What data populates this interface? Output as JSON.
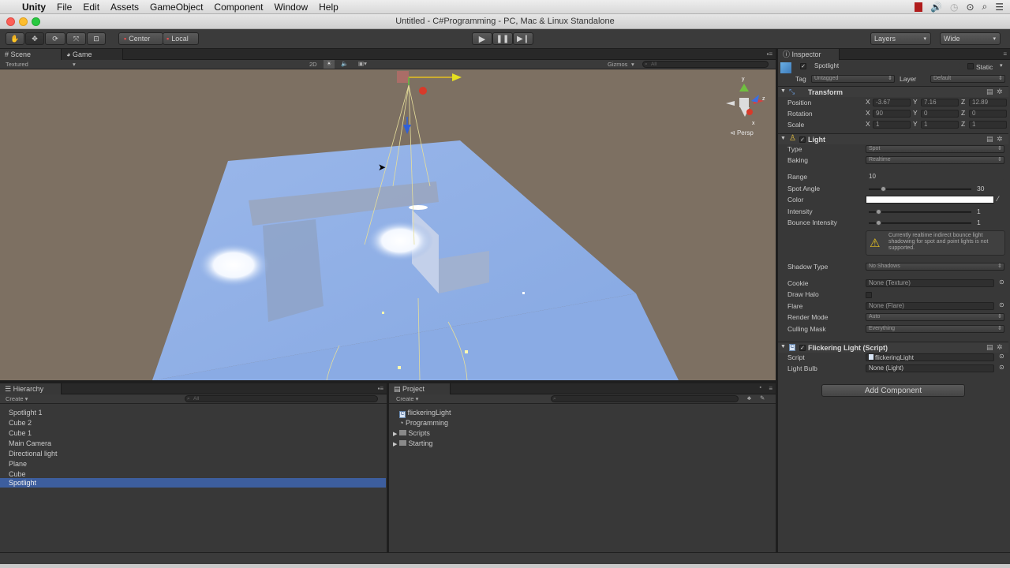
{
  "menubar": {
    "app": "Unity",
    "items": [
      "File",
      "Edit",
      "Assets",
      "GameObject",
      "Component",
      "Window",
      "Help"
    ]
  },
  "window": {
    "title": "Untitled - C#Programming - PC, Mac & Linux Standalone"
  },
  "toolbar": {
    "pivot": "Center",
    "space": "Local",
    "layers": "Layers",
    "layout": "Wide"
  },
  "scene": {
    "tab_scene": "Scene",
    "tab_game": "Game",
    "render_mode": "Textured",
    "btn_2d": "2D",
    "gizmos": "Gizmos",
    "search_placeholder": "All",
    "persp": "Persp"
  },
  "hierarchy": {
    "tab": "Hierarchy",
    "create": "Create",
    "search_placeholder": "All",
    "items": [
      "Spotlight 1",
      "Cube 2",
      "Cube 1",
      "Main Camera",
      "Directional light",
      "Plane",
      "Cube",
      "Spotlight"
    ],
    "selected": "Spotlight"
  },
  "project": {
    "tab": "Project",
    "create": "Create",
    "items": [
      {
        "label": "flickeringLight",
        "icon": "script-icon"
      },
      {
        "label": "Programming",
        "icon": "unity-scene-icon"
      },
      {
        "label": "Scripts",
        "icon": "folder-icon"
      },
      {
        "label": "Starting",
        "icon": "folder-icon"
      }
    ]
  },
  "inspector": {
    "tab": "Inspector",
    "object_name": "Spotlight",
    "static_label": "Static",
    "tag_label": "Tag",
    "tag_value": "Untagged",
    "layer_label": "Layer",
    "layer_value": "Default",
    "transform": {
      "title": "Transform",
      "position_label": "Position",
      "pos_x": "-3.67",
      "pos_y": "7.16",
      "pos_z": "12.89",
      "rotation_label": "Rotation",
      "rot_x": "90",
      "rot_y": "0",
      "rot_z": "0",
      "scale_label": "Scale",
      "scale_x": "1",
      "scale_y": "1",
      "scale_z": "1"
    },
    "light": {
      "title": "Light",
      "type_label": "Type",
      "type_value": "Spot",
      "baking_label": "Baking",
      "baking_value": "Realtime",
      "range_label": "Range",
      "range_value": "10",
      "spot_angle_label": "Spot Angle",
      "spot_angle_value": "30",
      "color_label": "Color",
      "color_value": "#ffffff",
      "intensity_label": "Intensity",
      "intensity_value": "1",
      "bounce_label": "Bounce Intensity",
      "bounce_value": "1",
      "warning": "Currently realtime indirect bounce light shadowing for spot and point lights is not supported.",
      "shadow_type_label": "Shadow Type",
      "shadow_type_value": "No Shadows",
      "cookie_label": "Cookie",
      "cookie_value": "None (Texture)",
      "draw_halo_label": "Draw Halo",
      "flare_label": "Flare",
      "flare_value": "None (Flare)",
      "render_mode_label": "Render Mode",
      "render_mode_value": "Auto",
      "culling_mask_label": "Culling Mask",
      "culling_mask_value": "Everything"
    },
    "script_comp": {
      "title": "Flickering Light (Script)",
      "script_label": "Script",
      "script_value": "flickeringLight",
      "bulb_label": "Light Bulb",
      "bulb_value": "None (Light)"
    },
    "add_component": "Add Component"
  },
  "colors": {
    "scene_bg": "#7d7062",
    "plane": "#8fb0e6",
    "selection": "#3d5e9e"
  }
}
